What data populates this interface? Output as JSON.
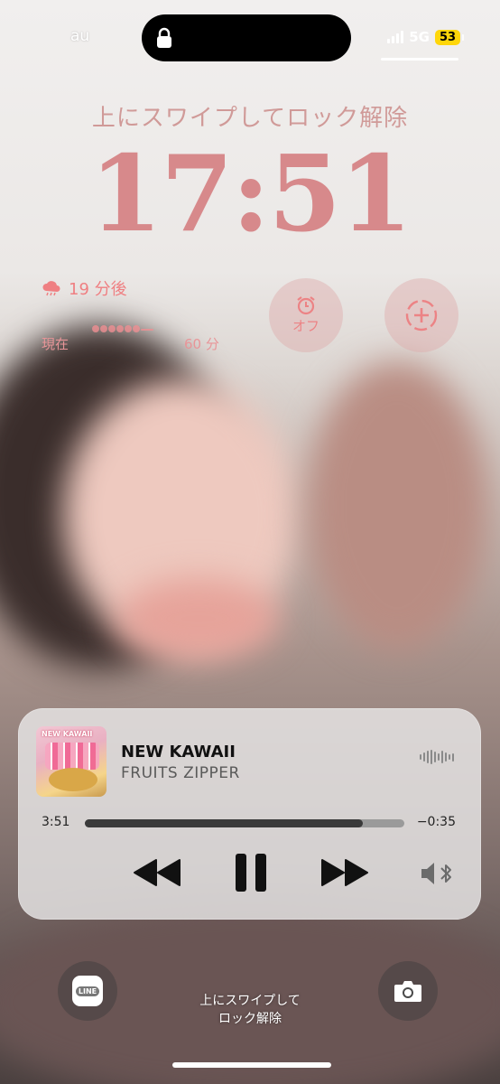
{
  "status_bar": {
    "carrier": "au",
    "network": "5G",
    "battery": "53"
  },
  "lock_screen": {
    "swipe_hint_top": "上にスワイプしてロック解除",
    "time": "17:51",
    "swipe_hint_bottom_line1": "上にスワイプして",
    "swipe_hint_bottom_line2": "ロック解除"
  },
  "widgets": {
    "rain": {
      "label": "19 分後",
      "start": "現在",
      "end": "60 分"
    },
    "alarm": {
      "label": "オフ",
      "icon": "alarm-clock-icon"
    },
    "add": {
      "icon": "add-widget-icon"
    }
  },
  "now_playing": {
    "title": "NEW KAWAII",
    "artist": "FRUITS ZIPPER",
    "album_art_text": "NEW KAWAII",
    "elapsed": "3:51",
    "remaining": "−0:35",
    "progress": 0.87
  },
  "shortcuts": {
    "left": "line-app-icon",
    "left_label": "LINE",
    "right": "camera-icon"
  },
  "colors": {
    "clock": "#d7898b",
    "accent_pink": "#ef7f82",
    "battery": "#ffd60a"
  }
}
